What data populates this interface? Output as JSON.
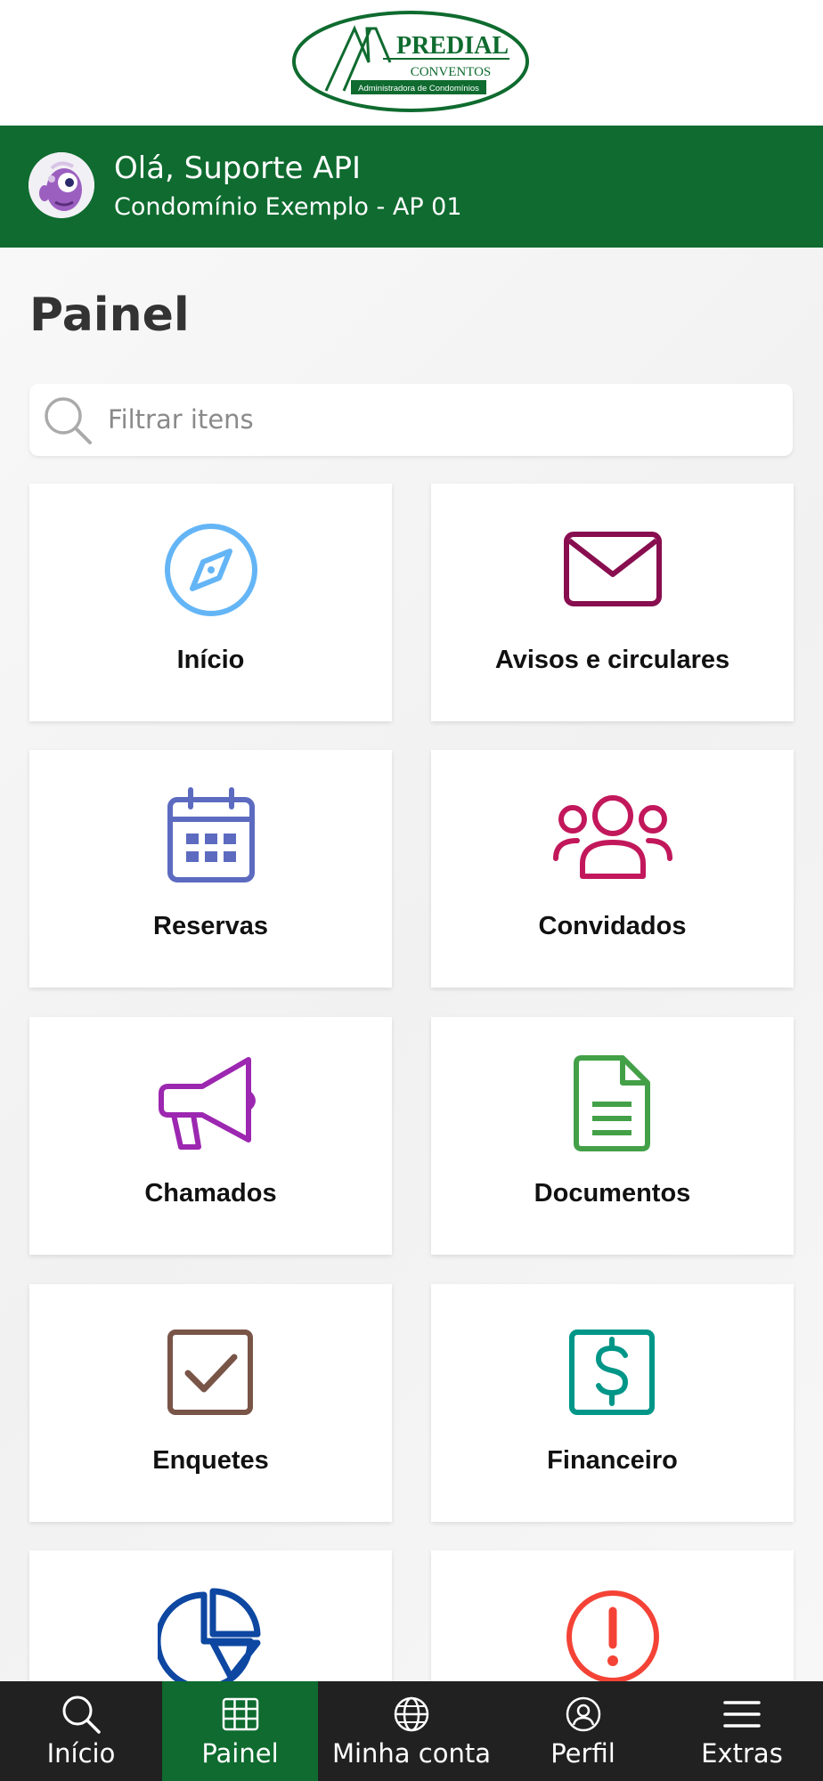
{
  "logo": {
    "brand": "PREDIAL",
    "sub": "CONVENTOS",
    "tagline": "Administradora de Condomínios"
  },
  "header": {
    "greeting": "Olá, Suporte API",
    "condo": "Condomínio Exemplo - AP 01"
  },
  "page": {
    "title": "Painel"
  },
  "search": {
    "placeholder": "Filtrar itens"
  },
  "cards": [
    {
      "label": "Início",
      "icon": "compass-icon",
      "color": "#64b5f6"
    },
    {
      "label": "Avisos e circulares",
      "icon": "envelope-icon",
      "color": "#880e4f"
    },
    {
      "label": "Reservas",
      "icon": "calendar-icon",
      "color": "#5c6bc0"
    },
    {
      "label": "Convidados",
      "icon": "users-icon",
      "color": "#c2185b"
    },
    {
      "label": "Chamados",
      "icon": "megaphone-icon",
      "color": "#9c27b0"
    },
    {
      "label": "Documentos",
      "icon": "document-icon",
      "color": "#43a047"
    },
    {
      "label": "Enquetes",
      "icon": "checkbox-icon",
      "color": "#795548"
    },
    {
      "label": "Financeiro",
      "icon": "dollar-icon",
      "color": "#009688"
    },
    {
      "label": "",
      "icon": "pie-chart-icon",
      "color": "#0d47a1"
    },
    {
      "label": "",
      "icon": "alert-icon",
      "color": "#f44336"
    }
  ],
  "nav": {
    "items": [
      {
        "label": "Início",
        "icon": "search-icon"
      },
      {
        "label": "Painel",
        "icon": "grid-icon",
        "active": true
      },
      {
        "label": "Minha conta",
        "icon": "globe-icon"
      },
      {
        "label": "Perfil",
        "icon": "user-circle-icon"
      },
      {
        "label": "Extras",
        "icon": "menu-icon"
      }
    ],
    "active_color": "#0f6b2f",
    "background": "#212121"
  },
  "colors": {
    "header_green": "#0f6b2f"
  }
}
